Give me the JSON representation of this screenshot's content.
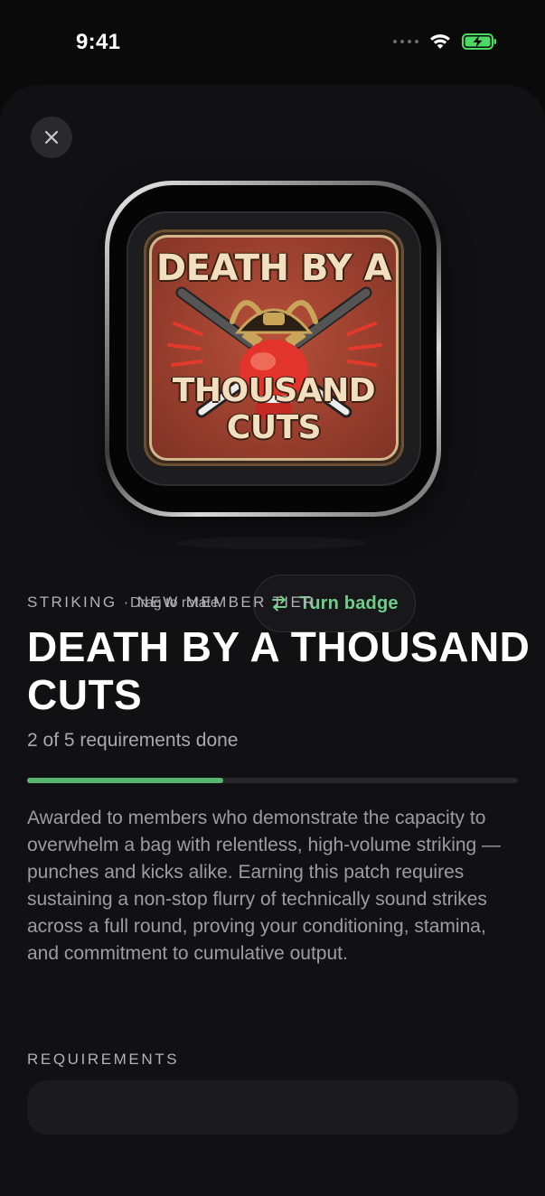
{
  "status_bar": {
    "time": "9:41",
    "icons": [
      "signal-dots-icon",
      "wifi-icon",
      "battery-charging-icon"
    ],
    "battery_color": "#4cd964"
  },
  "header": {
    "close_icon": "close-icon"
  },
  "badge": {
    "patch_text_top": "DEATH BY A",
    "patch_text_bottom": "THOUSAND CUTS",
    "art_elements": [
      "samurai-helmet",
      "red-boxing-glove",
      "crossed-katanas"
    ]
  },
  "controls": {
    "drag_hint": "Drag to rotate",
    "turn_badge_label": "Turn badge",
    "turn_icon": "swap-arrows-icon"
  },
  "details": {
    "eyebrow": "STRIKING · NEW MEMBER TIER",
    "title": "DEATH BY A THOUSAND CUTS",
    "progress_text": "2 of 5 requirements done",
    "progress": {
      "done": 2,
      "total": 5
    },
    "description": "Awarded to members who demonstrate the capacity to overwhelm a bag with relentless, high-volume striking — punches and kicks alike. Earning this patch requires sustaining a non-stop flurry of technically sound strikes across a full round, proving your conditioning, stamina, and commitment to cumulative output."
  },
  "requirements": {
    "heading": "REQUIREMENTS"
  },
  "colors": {
    "accent": "#6fce8a",
    "progress_fill": "#58b56f",
    "background": "#0a0a0b",
    "sheet": "#111113",
    "patch_red": "#9a3f2e",
    "patch_cream": "#f2dfbf"
  }
}
